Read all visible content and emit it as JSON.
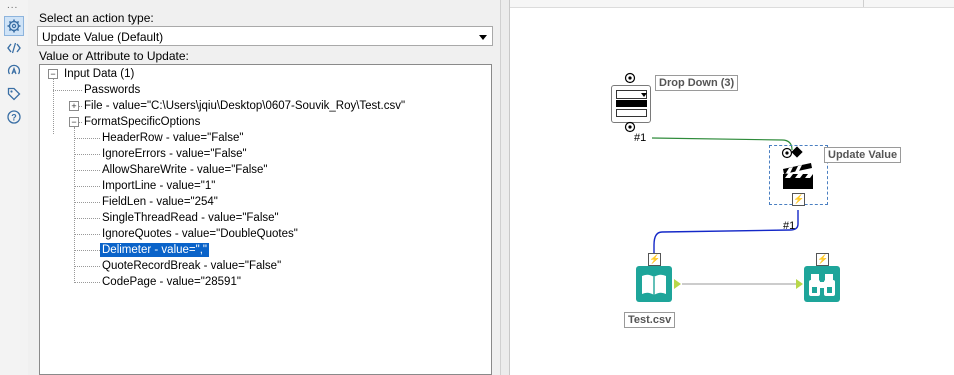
{
  "rail": {
    "dots": "...",
    "buttons": [
      {
        "name": "settings-gear-icon",
        "active": true
      },
      {
        "name": "code-xml-icon",
        "active": false
      },
      {
        "name": "rename-annotation-icon",
        "active": false
      },
      {
        "name": "tag-icon",
        "active": false
      },
      {
        "name": "help-question-icon",
        "active": false
      }
    ]
  },
  "config": {
    "action_type_label": "Select an action type:",
    "action_type_value": "Update Value (Default)",
    "update_label": "Value or Attribute to Update:",
    "tree": [
      {
        "text": "Input Data (1)",
        "level": 0,
        "expander": "−"
      },
      {
        "text": "Passwords",
        "level": 1,
        "expander": ""
      },
      {
        "text": "File - value=\"C:\\Users\\jqiu\\Desktop\\0607-Souvik_Roy\\Test.csv\"",
        "level": 1,
        "expander": "+"
      },
      {
        "text": "FormatSpecificOptions",
        "level": 1,
        "expander": "−"
      },
      {
        "text": "HeaderRow - value=\"False\"",
        "level": 2,
        "expander": ""
      },
      {
        "text": "IgnoreErrors - value=\"False\"",
        "level": 2,
        "expander": ""
      },
      {
        "text": "AllowShareWrite - value=\"False\"",
        "level": 2,
        "expander": ""
      },
      {
        "text": "ImportLine - value=\"1\"",
        "level": 2,
        "expander": ""
      },
      {
        "text": "FieldLen - value=\"254\"",
        "level": 2,
        "expander": ""
      },
      {
        "text": "SingleThreadRead - value=\"False\"",
        "level": 2,
        "expander": ""
      },
      {
        "text": "IgnoreQuotes - value=\"DoubleQuotes\"",
        "level": 2,
        "expander": ""
      },
      {
        "text": "Delimeter - value=\",\"",
        "level": 2,
        "expander": "",
        "selected": true
      },
      {
        "text": "QuoteRecordBreak - value=\"False\"",
        "level": 2,
        "expander": ""
      },
      {
        "text": "CodePage - value=\"28591\"",
        "level": 2,
        "expander": ""
      }
    ]
  },
  "canvas": {
    "tools": {
      "drop_down": {
        "label": "Drop Down (3)"
      },
      "update_value": {
        "label": "Update Value"
      },
      "input": {
        "label": "Test.csv"
      },
      "browse": {
        "label": ""
      }
    },
    "anchors": {
      "drop_down_out": "#1",
      "update_in": "#1"
    },
    "colors": {
      "teal": "#1ea59a",
      "question_connection": "#2e8b3a",
      "action_connection": "#1428c8",
      "selection": "#0a63c9"
    }
  }
}
